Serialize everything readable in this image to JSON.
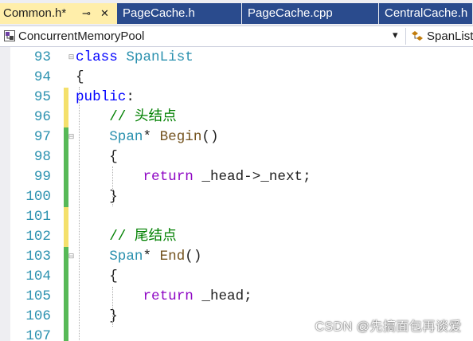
{
  "tabs": [
    {
      "label": "Common.h*",
      "pin_icon": "⊸",
      "close_icon": "✕",
      "active": true
    },
    {
      "label": "PageCache.h",
      "active": false
    },
    {
      "label": "PageCache.cpp",
      "active": false
    },
    {
      "label": "CentralCache.h",
      "active": false
    }
  ],
  "navbar": {
    "project": "ConcurrentMemoryPool",
    "dropdown_icon": "▾",
    "scope": "SpanList"
  },
  "colors": {
    "line_number": "#2b91af",
    "keyword": "#0000ff",
    "comment": "#008000",
    "type": "#2b91af",
    "function": "#74531f",
    "control_keyword": "#8f08c4",
    "change_saved": "#57b957",
    "change_unsaved": "#f4e06b"
  },
  "code_lines": [
    {
      "num": "93",
      "change": "none",
      "fold": "-",
      "tokens": [
        {
          "t": "class ",
          "c": "kw"
        },
        {
          "t": "SpanList",
          "c": "ty"
        }
      ]
    },
    {
      "num": "94",
      "change": "none",
      "tokens": [
        {
          "t": "{",
          "c": "pl"
        }
      ]
    },
    {
      "num": "95",
      "change": "unsaved",
      "tokens": [
        {
          "t": "public",
          "c": "kw"
        },
        {
          "t": ":",
          "c": "pl"
        }
      ]
    },
    {
      "num": "96",
      "change": "unsaved",
      "tokens": [
        {
          "t": "    // 头结点",
          "c": "cm"
        }
      ]
    },
    {
      "num": "97",
      "change": "saved",
      "fold": "-",
      "tokens": [
        {
          "t": "    ",
          "c": "pl"
        },
        {
          "t": "Span",
          "c": "ty"
        },
        {
          "t": "* ",
          "c": "pl"
        },
        {
          "t": "Begin",
          "c": "fn"
        },
        {
          "t": "()",
          "c": "pl"
        }
      ]
    },
    {
      "num": "98",
      "change": "saved",
      "tokens": [
        {
          "t": "    {",
          "c": "pl"
        }
      ]
    },
    {
      "num": "99",
      "change": "saved",
      "tokens": [
        {
          "t": "        ",
          "c": "pl"
        },
        {
          "t": "return",
          "c": "ret"
        },
        {
          "t": " _head->_next;",
          "c": "pl"
        }
      ]
    },
    {
      "num": "100",
      "change": "saved",
      "tokens": [
        {
          "t": "    }",
          "c": "pl"
        }
      ]
    },
    {
      "num": "101",
      "change": "unsaved",
      "tokens": []
    },
    {
      "num": "102",
      "change": "unsaved",
      "tokens": [
        {
          "t": "    // 尾结点",
          "c": "cm"
        }
      ]
    },
    {
      "num": "103",
      "change": "saved",
      "fold": "-",
      "tokens": [
        {
          "t": "    ",
          "c": "pl"
        },
        {
          "t": "Span",
          "c": "ty"
        },
        {
          "t": "* ",
          "c": "pl"
        },
        {
          "t": "End",
          "c": "fn"
        },
        {
          "t": "()",
          "c": "pl"
        }
      ]
    },
    {
      "num": "104",
      "change": "saved",
      "tokens": [
        {
          "t": "    {",
          "c": "pl"
        }
      ]
    },
    {
      "num": "105",
      "change": "saved",
      "tokens": [
        {
          "t": "        ",
          "c": "pl"
        },
        {
          "t": "return",
          "c": "ret"
        },
        {
          "t": " _head;",
          "c": "pl"
        }
      ]
    },
    {
      "num": "106",
      "change": "saved",
      "tokens": [
        {
          "t": "    }",
          "c": "pl"
        }
      ]
    },
    {
      "num": "107",
      "change": "saved",
      "tokens": []
    }
  ],
  "watermark": "CSDN @先搞面包再谈爱"
}
